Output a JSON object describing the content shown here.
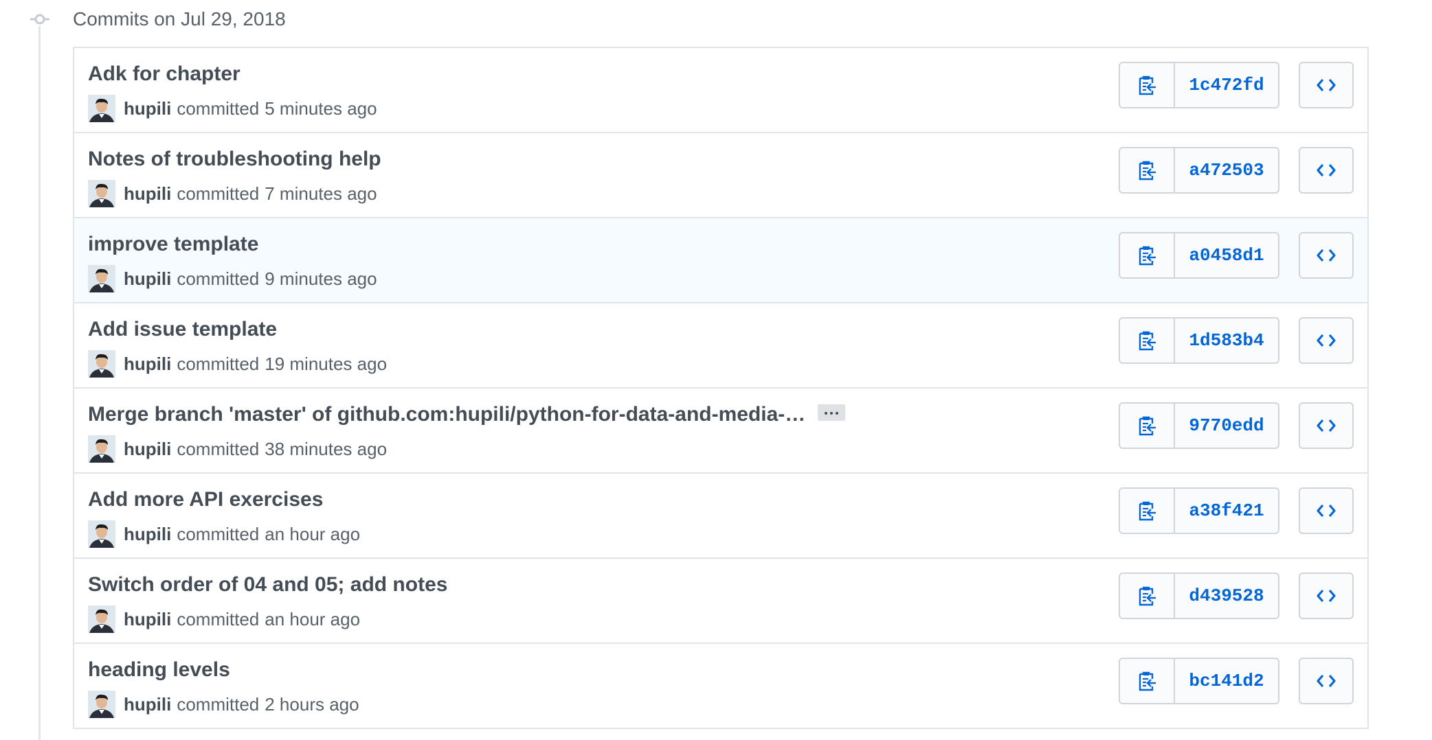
{
  "group": {
    "title": "Commits on Jul 29, 2018"
  },
  "colors": {
    "link_blue": "#0366d6",
    "title_gray": "#444d56",
    "meta_gray": "#586069",
    "border": "#e1e4e8",
    "highlight_row": "#f6fbff"
  },
  "icons": {
    "timeline": "git-commit-icon",
    "copy": "clippy-icon",
    "browse": "code-icon",
    "expand": "ellipsis-icon"
  },
  "commits": [
    {
      "title": "Adk for chapter",
      "author": "hupili",
      "action": "committed",
      "time": "5 minutes ago",
      "sha": "1c472fd",
      "expandable": false,
      "highlighted": false
    },
    {
      "title": "Notes of troubleshooting help",
      "author": "hupili",
      "action": "committed",
      "time": "7 minutes ago",
      "sha": "a472503",
      "expandable": false,
      "highlighted": false
    },
    {
      "title": "improve template",
      "author": "hupili",
      "action": "committed",
      "time": "9 minutes ago",
      "sha": "a0458d1",
      "expandable": false,
      "highlighted": true
    },
    {
      "title": "Add issue template",
      "author": "hupili",
      "action": "committed",
      "time": "19 minutes ago",
      "sha": "1d583b4",
      "expandable": false,
      "highlighted": false
    },
    {
      "title": "Merge branch 'master' of github.com:hupili/python-for-data-and-media-…",
      "author": "hupili",
      "action": "committed",
      "time": "38 minutes ago",
      "sha": "9770edd",
      "expandable": true,
      "highlighted": false
    },
    {
      "title": "Add more API exercises",
      "author": "hupili",
      "action": "committed",
      "time": "an hour ago",
      "sha": "a38f421",
      "expandable": false,
      "highlighted": false
    },
    {
      "title": "Switch order of 04 and 05; add notes",
      "author": "hupili",
      "action": "committed",
      "time": "an hour ago",
      "sha": "d439528",
      "expandable": false,
      "highlighted": false
    },
    {
      "title": "heading levels",
      "author": "hupili",
      "action": "committed",
      "time": "2 hours ago",
      "sha": "bc141d2",
      "expandable": false,
      "highlighted": false
    }
  ]
}
